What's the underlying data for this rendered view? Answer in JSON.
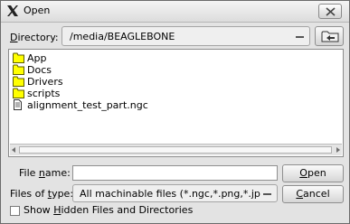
{
  "window": {
    "title": "Open"
  },
  "directory": {
    "label_pre": "",
    "label_mnemonic": "D",
    "label_post": "irectory:",
    "value": "/media/BEAGLEBONE"
  },
  "files": [
    {
      "name": "App",
      "kind": "folder-icon"
    },
    {
      "name": "Docs",
      "kind": "folder-icon"
    },
    {
      "name": "Drivers",
      "kind": "folder-icon"
    },
    {
      "name": "scripts",
      "kind": "folder-icon"
    },
    {
      "name": "alignment_test_part.ngc",
      "kind": "file-icon"
    }
  ],
  "file_name": {
    "label_pre": "File ",
    "label_mnemonic": "n",
    "label_post": "ame:",
    "value": ""
  },
  "file_type": {
    "label_pre": "Files of ",
    "label_mnemonic": "t",
    "label_post": "ype:",
    "value": "All machinable files (*.ngc,*.png,*.jpg,...)"
  },
  "buttons": {
    "open_mnemonic": "O",
    "open_rest": "pen",
    "cancel_mnemonic": "C",
    "cancel_rest": "ancel"
  },
  "hidden_toggle": {
    "label_pre": "Show ",
    "label_mnemonic": "H",
    "label_post": "idden Files and Directories",
    "checked": false
  },
  "colors": {
    "folder_fill": "#ffff00",
    "folder_stroke": "#5a5a00"
  }
}
